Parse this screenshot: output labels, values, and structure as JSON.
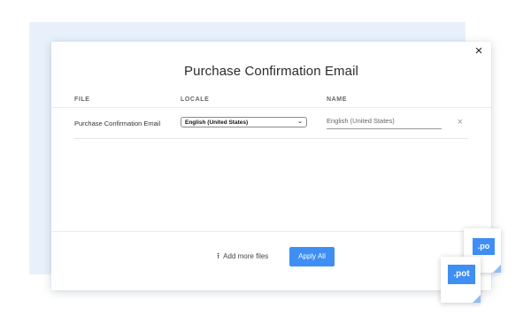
{
  "modal": {
    "title": "Purchase Confirmation Email",
    "close_icon": "×"
  },
  "table": {
    "headers": {
      "file": "FILE",
      "locale": "LOCALE",
      "name": "NAME"
    },
    "rows": [
      {
        "file": "Purchase Confirmation Email",
        "locale": "English (United States)",
        "name": "English (United States)",
        "remove_icon": "×"
      }
    ]
  },
  "footer": {
    "upload_icon": "⭱",
    "add_files_label": "Add more files",
    "apply_label": "Apply All"
  },
  "file_icons": [
    {
      "label": ".po"
    },
    {
      "label": ".pot"
    }
  ],
  "colors": {
    "accent": "#3f8ef4",
    "backdrop": "#e8f1fb"
  }
}
